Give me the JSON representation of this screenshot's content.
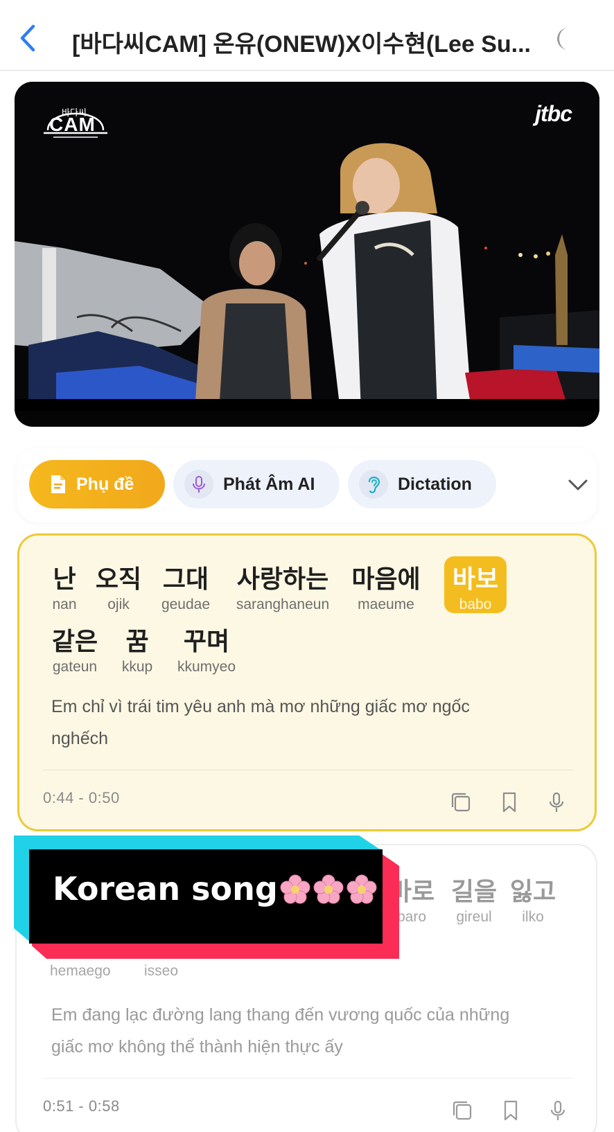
{
  "header": {
    "title": "[바다씨CAM] 온유(ONEW)X이수현(Lee Su...",
    "back_icon": "chevron-left-icon",
    "theme_icon": "moon-icon",
    "accent_color": "#2f7df6"
  },
  "video": {
    "logo_top": "바다씨",
    "logo_main": "CAM",
    "channel": "jtbc"
  },
  "tabs": [
    {
      "label": "Phụ đề",
      "icon": "document-icon",
      "active": true
    },
    {
      "label": "Phát Âm AI",
      "icon": "microphone-icon",
      "active": false
    },
    {
      "label": "Dictation",
      "icon": "ear-icon",
      "active": false
    }
  ],
  "lines": [
    {
      "words": [
        {
          "kr": "난",
          "rom": "nan"
        },
        {
          "kr": "오직",
          "rom": "ojik"
        },
        {
          "kr": "그대",
          "rom": "geudae"
        },
        {
          "kr": "사랑하는",
          "rom": "saranghaneun"
        },
        {
          "kr": "마음에",
          "rom": "maeume"
        },
        {
          "kr": "바보",
          "rom": "babo",
          "highlight": true
        },
        {
          "kr": "같은",
          "rom": "gateun"
        },
        {
          "kr": "꿈",
          "rom": "kkup"
        },
        {
          "kr": "꾸며",
          "rom": "kkumyeo"
        }
      ],
      "translation_1": "Em chỉ vì trái tim yêu anh mà mơ những giấc mơ ngốc",
      "translation_2": "nghếch",
      "time": "0:44 - 0:50"
    },
    {
      "words": [
        {
          "kr": "바로",
          "rom": "baro"
        },
        {
          "kr": "길을",
          "rom": "gireul"
        },
        {
          "kr": "잃고",
          "rom": "ilko"
        }
      ],
      "rom_row2": [
        {
          "rom": "hemaego"
        },
        {
          "rom": "isseo"
        }
      ],
      "translation_1": "Em đang lạc đường lang thang đến vương quốc của những",
      "translation_2": "giấc mơ không thể thành hiện thực ấy",
      "time": "0:51 - 0:58"
    }
  ],
  "actions": [
    "copy-icon",
    "bookmark-icon",
    "microphone-icon"
  ],
  "overlay": {
    "text": "Korean song",
    "emoji_count": 3
  },
  "colors": {
    "highlight": "#f4bd1f",
    "active_card_bg": "#fdf8e4",
    "active_card_border": "#edc936",
    "overlay_cyan": "#1fd2e8",
    "overlay_red": "#fb2c55"
  }
}
